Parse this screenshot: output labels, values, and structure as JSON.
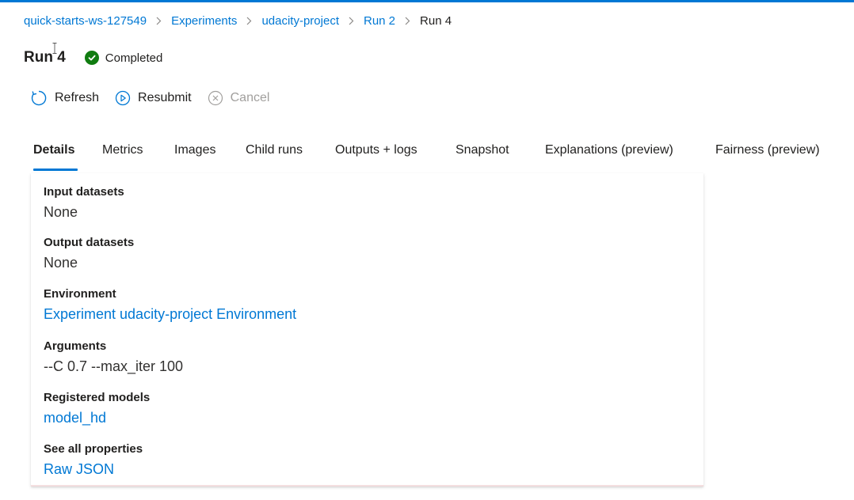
{
  "breadcrumb": {
    "items": [
      {
        "label": "quick-starts-ws-127549"
      },
      {
        "label": "Experiments"
      },
      {
        "label": "udacity-project"
      },
      {
        "label": "Run 2"
      }
    ],
    "current": "Run 4"
  },
  "header": {
    "title": "Run 4",
    "status": "Completed",
    "status_color": "#107c10"
  },
  "toolbar": {
    "refresh_label": "Refresh",
    "resubmit_label": "Resubmit",
    "cancel_label": "Cancel"
  },
  "tabs": [
    {
      "label": "Details",
      "active": true
    },
    {
      "label": "Metrics"
    },
    {
      "label": "Images"
    },
    {
      "label": "Child runs"
    },
    {
      "label": "Outputs + logs"
    },
    {
      "label": "Snapshot"
    },
    {
      "label": "Explanations (preview)"
    },
    {
      "label": "Fairness (preview)"
    }
  ],
  "details": {
    "input_datasets": {
      "label": "Input datasets",
      "value": "None"
    },
    "output_datasets": {
      "label": "Output datasets",
      "value": "None"
    },
    "environment": {
      "label": "Environment",
      "value": "Experiment udacity-project Environment"
    },
    "arguments": {
      "label": "Arguments",
      "value": "--C 0.7 --max_iter 100"
    },
    "registered_models": {
      "label": "Registered models",
      "value": "model_hd"
    },
    "properties": {
      "label": "See all properties",
      "value": "Raw JSON"
    }
  },
  "colors": {
    "accent": "#0078d4",
    "text": "#201f1e",
    "disabled": "#a19f9d"
  }
}
